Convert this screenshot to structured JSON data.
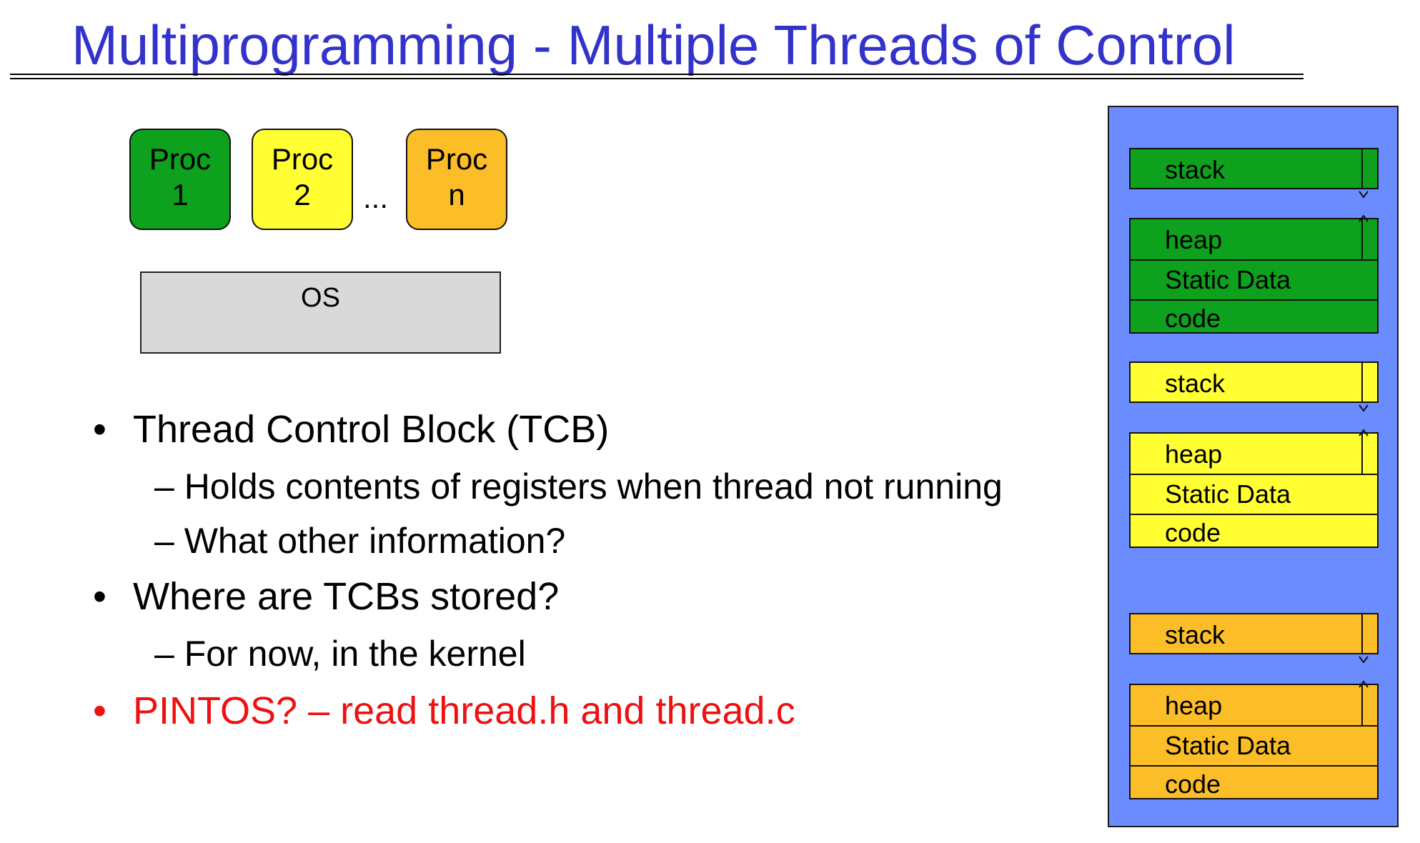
{
  "title": "Multiprogramming - Multiple Threads of Control",
  "procs": [
    {
      "line1": "Proc",
      "line2": "1",
      "color": "#0ea11e"
    },
    {
      "line1": "Proc",
      "line2": "2",
      "color": "#ffff33"
    },
    {
      "line1": "Proc",
      "line2": "n",
      "color": "#fbbd28"
    }
  ],
  "ellipsis": "...",
  "os_label": "OS",
  "bullets": {
    "b1": "Thread Control Block (TCB)",
    "b1_sub1": "– Holds contents of registers when thread not running",
    "b1_sub2": "– What other information?",
    "b2": "Where are TCBs stored?",
    "b2_sub1": "– For now, in the kernel",
    "b3": "PINTOS? – read thread.h and thread.c",
    "bullet_char": "•"
  },
  "memory": {
    "stack": "stack",
    "heap": "heap",
    "static": "Static Data",
    "code": "code"
  },
  "colors": {
    "title": "#3333cc",
    "memory_bg": "#6a8cff",
    "red_text": "#ee1111"
  }
}
